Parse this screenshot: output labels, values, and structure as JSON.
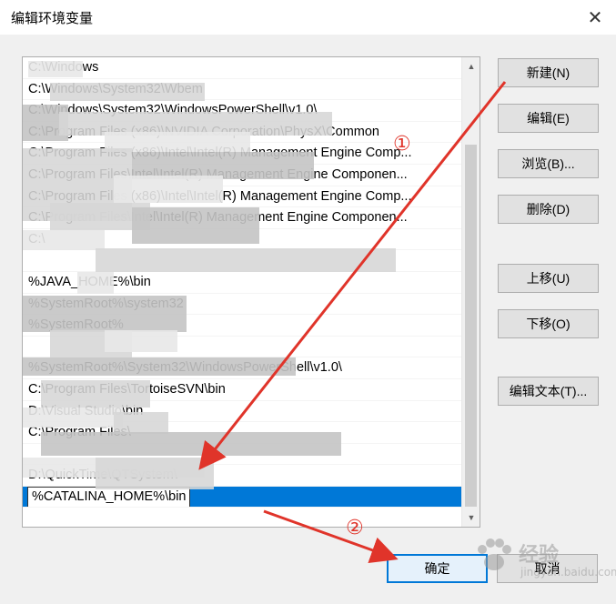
{
  "window": {
    "title": "编辑环境变量",
    "close_glyph": "✕"
  },
  "list": {
    "items": [
      "C:\\Windows",
      "C:\\Windows\\System32\\Wbem",
      "C:\\Windows\\System32\\WindowsPowerShell\\v1.0\\",
      "C:\\Program Files (x86)\\NVIDIA Corporation\\PhysX\\Common",
      "C:\\Program Files (x86)\\Intel\\Intel(R) Management Engine Comp...",
      "C:\\Program Files\\Intel\\Intel(R) Management Engine Componen...",
      "C:\\Program Files (x86)\\Intel\\Intel(R) Management Engine Comp...",
      "C:\\Program Files\\Intel\\Intel(R) Management Engine Componen...",
      "C:\\",
      "",
      "%JAVA_HOME%\\bin",
      "%SystemRoot%\\system32",
      "%SystemRoot%",
      "",
      "%SystemRoot%\\System32\\WindowsPowerShell\\v1.0\\",
      "C:\\Program Files\\TortoiseSVN\\bin",
      "D:\\Visual Studio\\bin",
      "C:\\Program Files\\",
      "",
      "D:\\QuickTime\\QTSystem\\"
    ],
    "editing_value": "%CATALINA_HOME%\\bin"
  },
  "scrollbar": {
    "up_glyph": "▲",
    "down_glyph": "▼"
  },
  "buttons": {
    "new": "新建(N)",
    "edit": "编辑(E)",
    "browse": "浏览(B)...",
    "delete": "删除(D)",
    "move_up": "上移(U)",
    "move_down": "下移(O)",
    "edit_text": "编辑文本(T)...",
    "ok": "确定",
    "cancel": "取消"
  },
  "annotations": {
    "step1": "①",
    "step2": "②",
    "color": "#e0342a"
  },
  "watermark": {
    "text": "经验",
    "sub": "jingyan.baidu.com"
  }
}
